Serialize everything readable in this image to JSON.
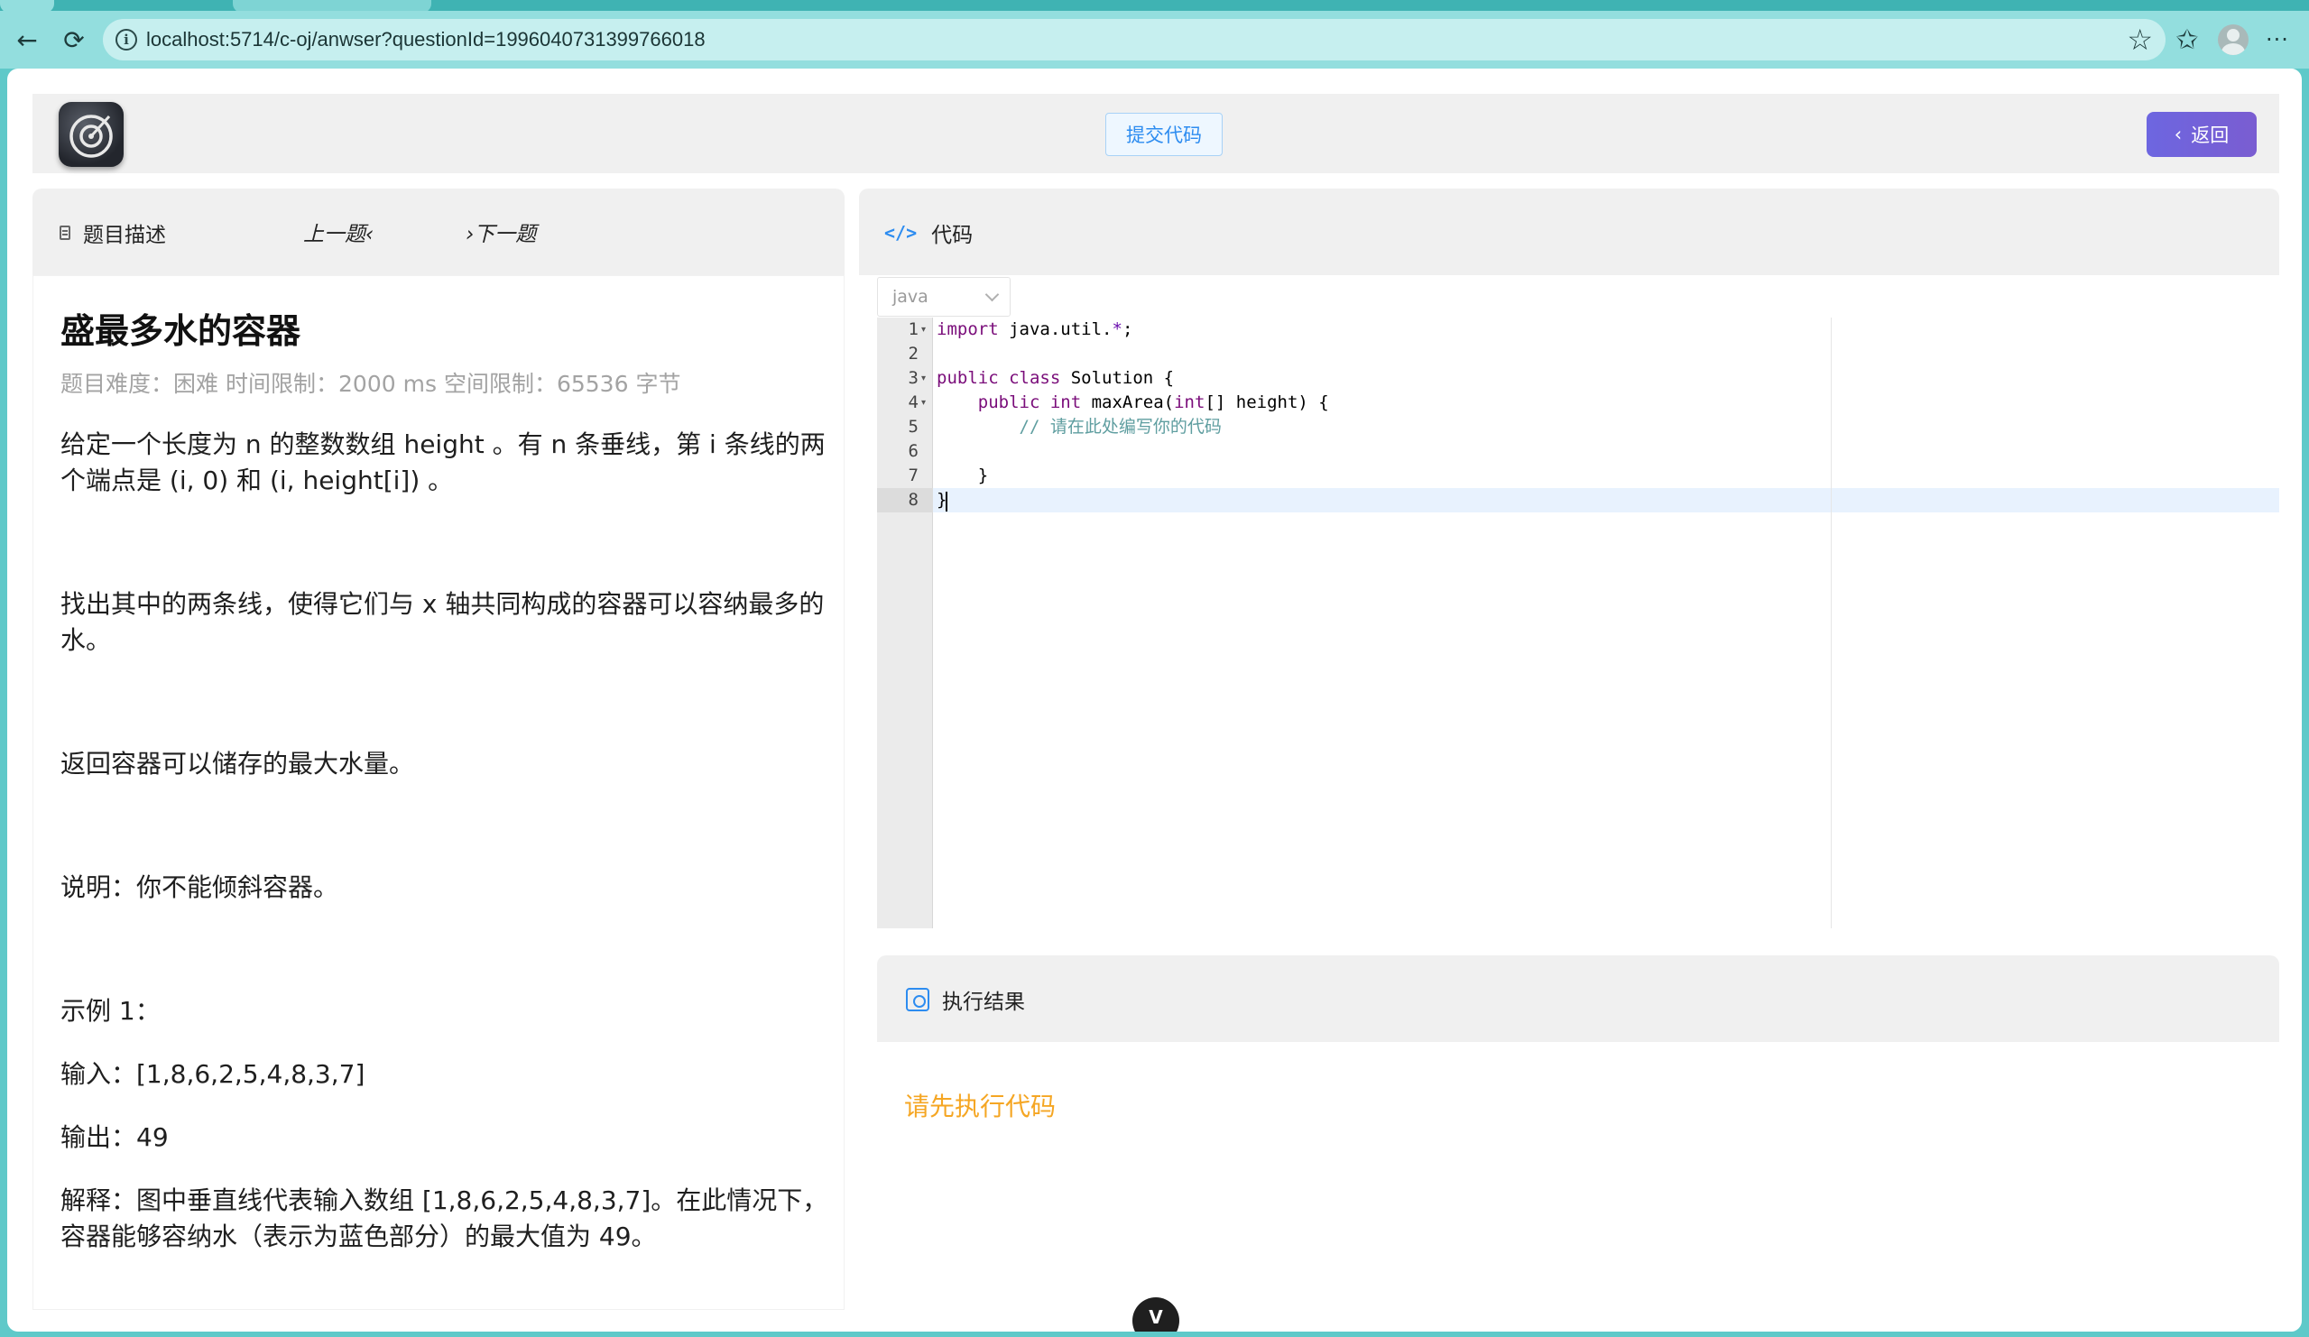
{
  "browser": {
    "url": "localhost:5714/c-oj/anwser?questionId=1996040731399766018"
  },
  "header": {
    "submit_label": "提交代码",
    "back_label": "返回"
  },
  "left_panel": {
    "tab_description": "题目描述",
    "prev_label": "上一题",
    "next_label": "下一题",
    "question_title": "盛最多水的容器",
    "meta": {
      "difficulty": "题目难度：困难",
      "time_limit": "时间限制：2000 ms",
      "memory_limit": "空间限制：65536 字节"
    },
    "paragraphs": [
      "给定一个长度为 n 的整数数组 height 。有 n 条垂线，第 i 条线的两个端点是 (i, 0) 和 (i, height[i]) 。",
      "找出其中的两条线，使得它们与 x 轴共同构成的容器可以容纳最多的水。",
      "返回容器可以储存的最大水量。",
      "说明：你不能倾斜容器。",
      "示例 1：",
      "输入：[1,8,6,2,5,4,8,3,7]",
      "输出：49",
      "解释：图中垂直线代表输入数组 [1,8,6,2,5,4,8,3,7]。在此情况下，容器能够容纳水（表示为蓝色部分）的最大值为 49。"
    ]
  },
  "code_panel": {
    "title": "代码",
    "language": "java",
    "line_numbers": [
      "1",
      "2",
      "3",
      "4",
      "5",
      "6",
      "7",
      "8"
    ],
    "code": {
      "l1_kw": "import",
      "l1_rest": " java.util.",
      "l1_star": "*",
      "l1_end": ";",
      "l3_kw": "public class",
      "l3_rest": " Solution {",
      "l4_indent": "    ",
      "l4_kw1": "public int",
      "l4_mid": " maxArea(",
      "l4_kw2": "int",
      "l4_end": "[] height) {",
      "l5": "        // 请在此处编写你的代码",
      "l7": "    }",
      "l8": "}"
    }
  },
  "result_panel": {
    "title": "执行结果",
    "message": "请先执行代码"
  },
  "icons": {
    "back": "arrow-left-icon",
    "reload": "reload-icon",
    "info": "info-icon",
    "star": "star-icon",
    "favorites": "favorites-icon",
    "profile": "avatar-icon",
    "more": "more-icon"
  },
  "colors": {
    "accent_blue": "#2d8cf0",
    "warning_orange": "#f5a623",
    "back_button": "#6d66e0",
    "browser_teal": "#93dede"
  }
}
